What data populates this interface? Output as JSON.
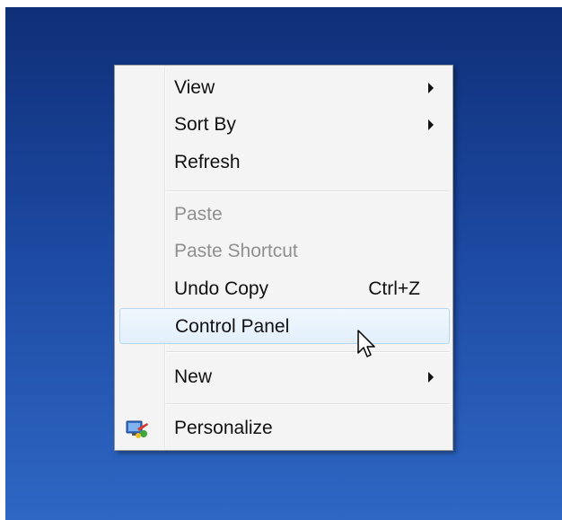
{
  "context_menu": {
    "items": [
      {
        "label": "View",
        "submenu": true,
        "enabled": true
      },
      {
        "label": "Sort By",
        "submenu": true,
        "enabled": true
      },
      {
        "label": "Refresh",
        "submenu": false,
        "enabled": true
      },
      {
        "label": "Paste",
        "submenu": false,
        "enabled": false
      },
      {
        "label": "Paste Shortcut",
        "submenu": false,
        "enabled": false
      },
      {
        "label": "Undo Copy",
        "shortcut": "Ctrl+Z",
        "submenu": false,
        "enabled": true
      },
      {
        "label": "Control Panel",
        "submenu": false,
        "enabled": true,
        "highlighted": true
      },
      {
        "label": "New",
        "submenu": true,
        "enabled": true
      },
      {
        "label": "Personalize",
        "submenu": false,
        "enabled": true,
        "icon": "personalize-icon"
      }
    ]
  },
  "colors": {
    "desktop_top": "#0f2f78",
    "desktop_bottom": "#2e67c4",
    "menu_background": "#f4f4f4",
    "highlight_border": "#b8d6f0",
    "disabled_text": "#8f8f8f"
  },
  "icons": {
    "submenu_arrow": "chevron-right-icon",
    "cursor": "mouse-pointer-icon"
  }
}
